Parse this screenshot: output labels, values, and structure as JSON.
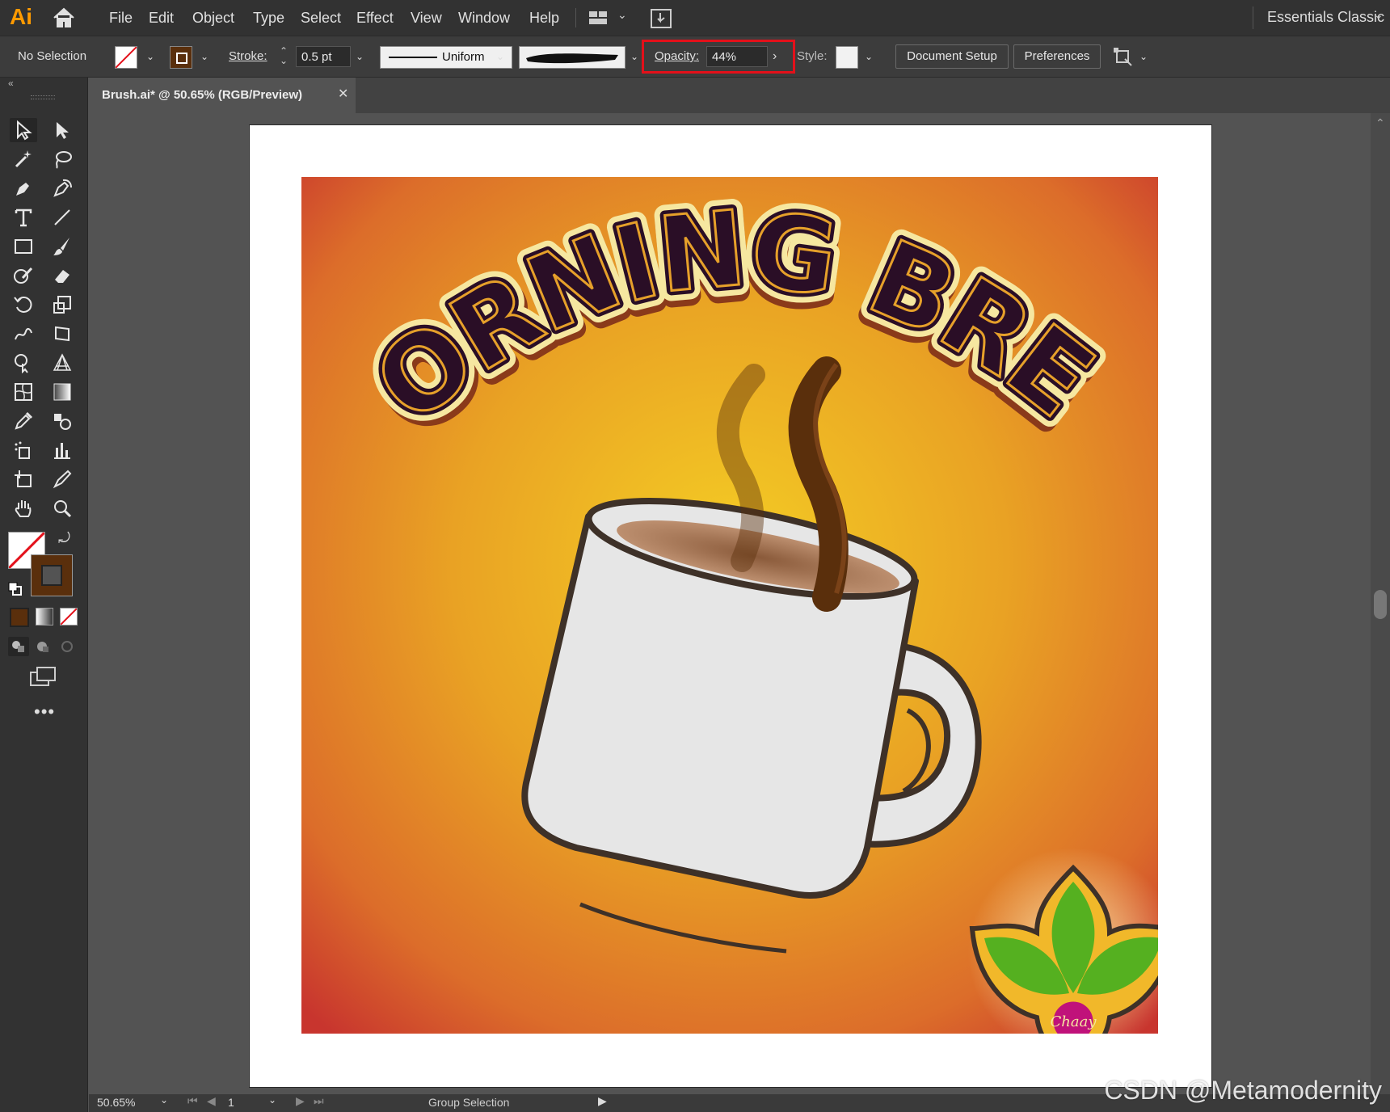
{
  "app": {
    "logo": "Ai",
    "workspace": "Essentials Classic"
  },
  "menu": [
    "File",
    "Edit",
    "Object",
    "Type",
    "Select",
    "Effect",
    "View",
    "Window",
    "Help"
  ],
  "control": {
    "selection": "No Selection",
    "stroke_label": "Stroke:",
    "stroke_weight": "0.5 pt",
    "profile": "Uniform",
    "opacity_label": "Opacity:",
    "opacity_value": "44%",
    "opacity_level": 0.44,
    "style_label": "Style:",
    "document_setup": "Document Setup",
    "preferences": "Preferences",
    "highlight_color": "#e3101a"
  },
  "document": {
    "tab_title": "Brush.ai* @ 50.65% (RGB/Preview)"
  },
  "artwork": {
    "headline": "MORNING BREW",
    "badge_text": "Chaay",
    "colors": {
      "bg_center": "#f4c824",
      "bg_edge": "#c8352e",
      "mug": "#e6e6e6",
      "outline": "#3e3128",
      "steam": "#5a2f0c",
      "letter_fill": "#2a0e26",
      "letter_outline": "#f6e7a0",
      "leaf": "#55b020",
      "badge": "#c0127a"
    }
  },
  "status": {
    "zoom": "50.65%",
    "artboard": "1",
    "tool": "Group Selection"
  },
  "watermark": "CSDN @Metamodernity"
}
